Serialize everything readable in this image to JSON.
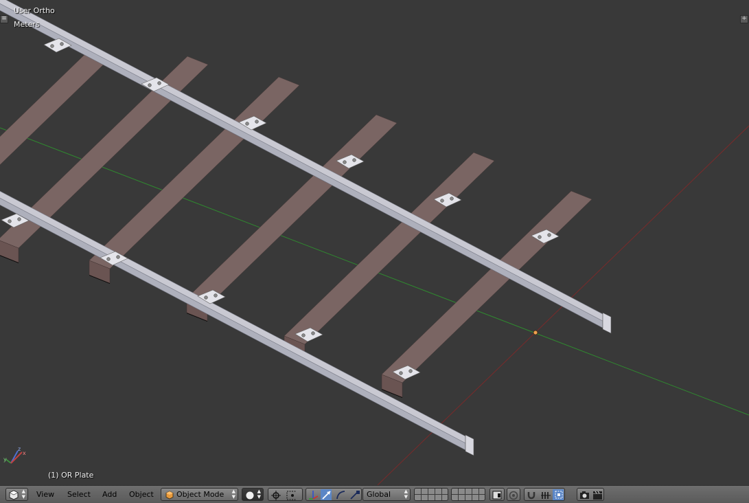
{
  "viewport": {
    "view_name": "User Ortho",
    "units": "Meters",
    "object_label": "(1) OR Plate",
    "corner_tl": "≡",
    "corner_tr": "+"
  },
  "header": {
    "editor_type_icon": "cube-icon",
    "menus": [
      "View",
      "Select",
      "Add",
      "Object"
    ],
    "mode": "Object Mode",
    "orientation": "Global"
  },
  "colors": {
    "viewport_bg": "#393939",
    "x_axis": "#7a2a2a",
    "y_axis": "#2f8a2f",
    "rail": "#c9c9d2",
    "sleeper": "#7a6563",
    "header_bg": "#6e6e6e"
  }
}
